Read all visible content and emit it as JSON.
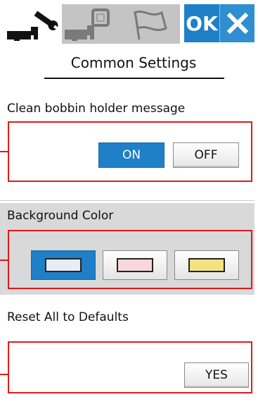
{
  "header": {
    "ok_label": "OK",
    "tabs": [
      {
        "icon": "wrench-sewing-machine-icon",
        "selected": true
      },
      {
        "icon": "embroidery-machine-icon",
        "selected": false
      },
      {
        "icon": "flag-icon",
        "selected": false
      }
    ],
    "close_icon": "close-icon",
    "accent_color": "#1f7fc7"
  },
  "page": {
    "title": "Common Settings"
  },
  "sections": {
    "bobbin": {
      "label": "Clean bobbin holder message",
      "on_label": "ON",
      "off_label": "OFF",
      "selected": "ON"
    },
    "background": {
      "label": "Background Color",
      "colors": [
        "#e8ecf6",
        "#f8d7dd",
        "#f3e37f"
      ],
      "selected_index": 0
    },
    "reset": {
      "label": "Reset All to Defaults",
      "yes_label": "YES"
    }
  },
  "annotation_color": "#e01a1a"
}
